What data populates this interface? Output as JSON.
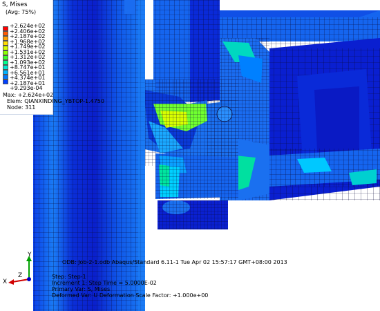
{
  "legend": {
    "title": "S, Mises",
    "subtitle": "(Avg: 75%)",
    "values": [
      "+2.624e+02",
      "+2.406e+02",
      "+2.187e+02",
      "+1.968e+02",
      "+1.749e+02",
      "+1.531e+02",
      "+1.312e+02",
      "+1.093e+02",
      "+8.747e+01",
      "+6.561e+01",
      "+4.374e+01",
      "+2.187e+01",
      "+9.293e-04"
    ],
    "colors": [
      "#ff0000",
      "#ff5a00",
      "#ffa000",
      "#ffdc00",
      "#d8ff00",
      "#8cff00",
      "#3cff2a",
      "#00ff8c",
      "#00e6d2",
      "#00b4ff",
      "#0078ff",
      "#0040ff",
      "#0000ff"
    ],
    "max": "Max: +2.624e+02",
    "elem": "Elem: QIANXINDING_YBTOP-1.4750",
    "node": "Node: 311"
  },
  "footer": {
    "odb": "ODB: Job-2-1.odb    Abaqus/Standard 6.11-1    Tue Apr 02 15:57:17 GMT+08:00 2013",
    "step": "Step: Step-1",
    "increment": "Increment    1: Step Time =    5.0000E-02",
    "primary": "Primary Var: S, Mises",
    "deformed": "Deformed Var: U   Deformation Scale Factor: +1.000e+00"
  },
  "triad": {
    "x": "X",
    "y": "Y",
    "z": "Z"
  },
  "colors": {
    "mesh_line": "#0a0a3a",
    "deep_blue": "#0a1fd6",
    "mid_blue": "#1565f0"
  }
}
